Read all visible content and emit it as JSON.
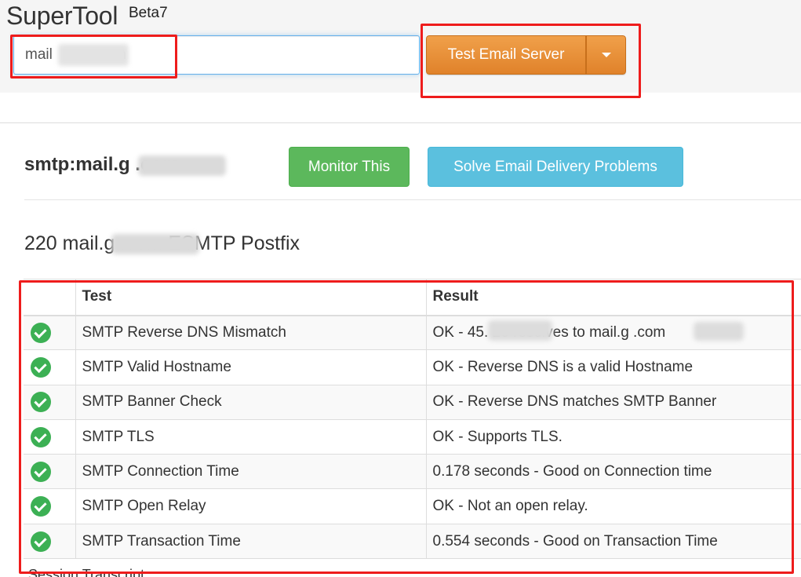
{
  "header": {
    "brand": "SuperTool",
    "badge": "Beta7",
    "search_value": "mail          .com",
    "test_button_label": "Test Email Server"
  },
  "result": {
    "host": "smtp:mail.g           .com",
    "monitor_label": "Monitor This",
    "solve_label": "Solve Email Delivery Problems",
    "banner": "220 mail.g           .com ESMTP Postfix"
  },
  "table": {
    "headers": [
      "",
      "Test",
      "Result"
    ],
    "rows": [
      {
        "test": "SMTP Reverse DNS Mismatch",
        "result": "OK - 45.             16 resolves to mail.g              .com",
        "status": "ok"
      },
      {
        "test": "SMTP Valid Hostname",
        "result": "OK - Reverse DNS is a valid Hostname",
        "status": "ok"
      },
      {
        "test": "SMTP Banner Check",
        "result": "OK - Reverse DNS matches SMTP Banner",
        "status": "ok"
      },
      {
        "test": "SMTP TLS",
        "result": "OK - Supports TLS.",
        "status": "ok"
      },
      {
        "test": "SMTP Connection Time",
        "result": "0.178 seconds - Good on Connection time",
        "status": "ok"
      },
      {
        "test": "SMTP Open Relay",
        "result": "OK - Not an open relay.",
        "status": "ok"
      },
      {
        "test": "SMTP Transaction Time",
        "result": "0.554 seconds - Good on Transaction Time",
        "status": "ok"
      }
    ]
  },
  "footer": {
    "transcript_label": "Session Transcript"
  },
  "colors": {
    "accent_orange": "#e88f37",
    "success_green": "#5cb85c",
    "info_cyan": "#5bc0de",
    "highlight_red": "#ee1c1c",
    "check_green": "#3cb054"
  },
  "icons": {
    "status_ok": "check-circle-icon",
    "dropdown": "caret-down-icon"
  }
}
